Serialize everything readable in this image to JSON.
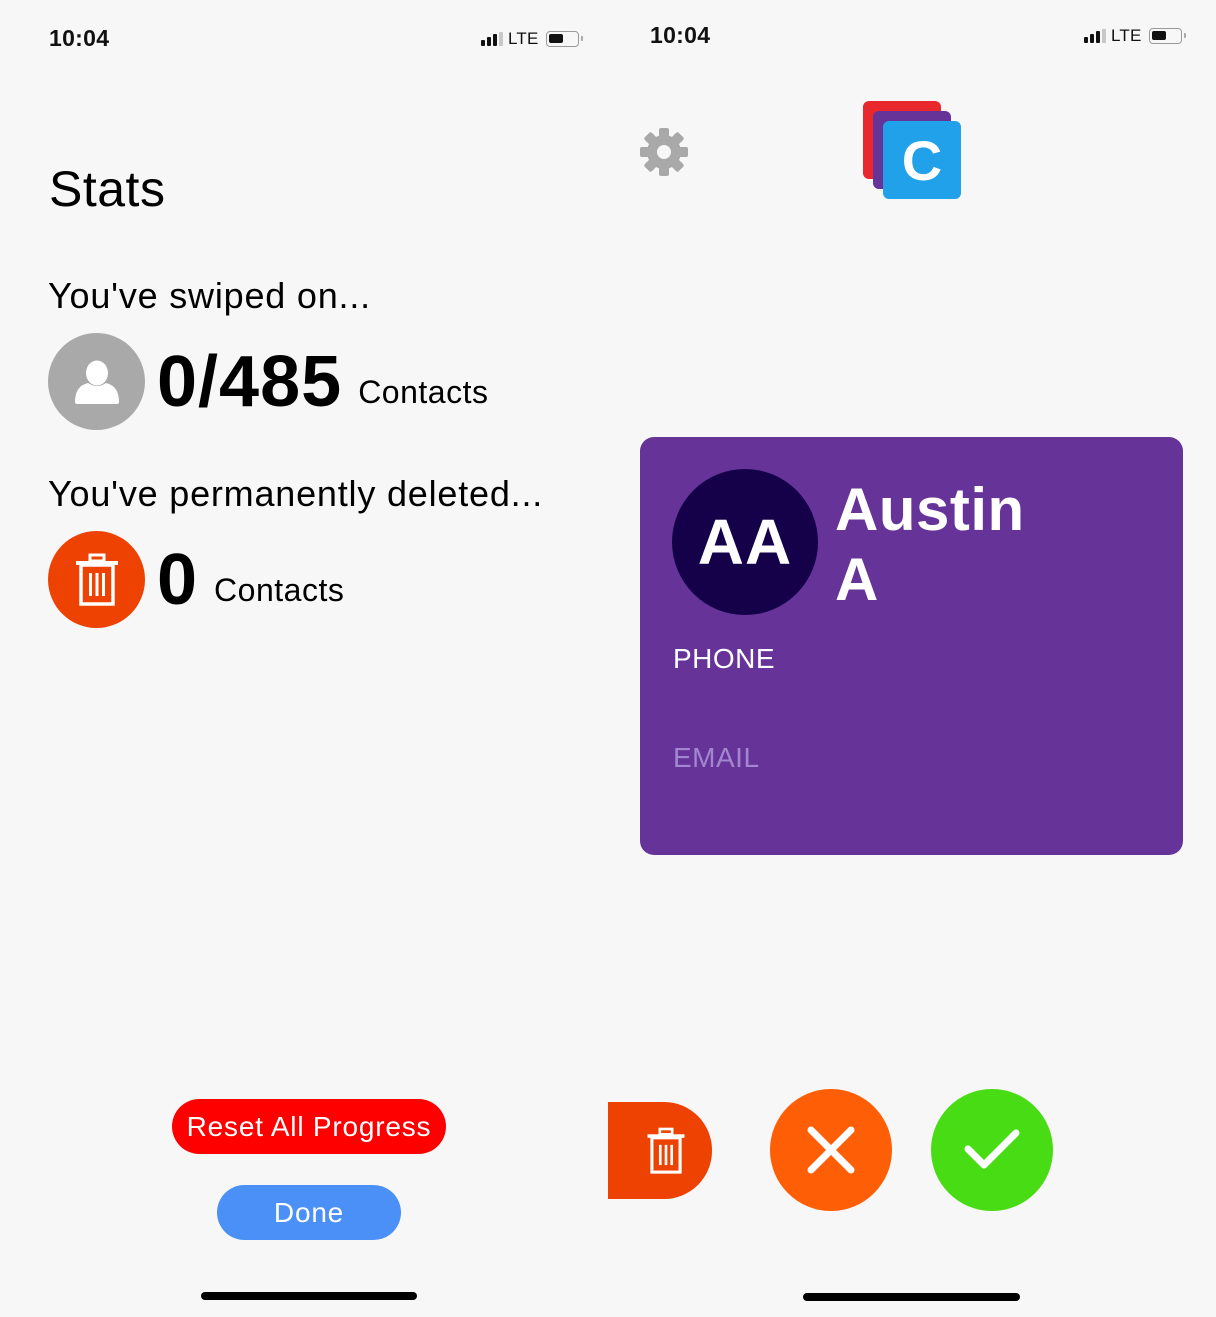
{
  "status_bar": {
    "time": "10:04",
    "network": "LTE",
    "signal_bars_filled": 3,
    "signal_bars_total": 4,
    "battery_level": 0.5
  },
  "stats_screen": {
    "title": "Stats",
    "swiped": {
      "label": "You've swiped on...",
      "value": "0/485",
      "unit": "Contacts",
      "icon": "person-icon"
    },
    "deleted": {
      "label": "You've permanently deleted...",
      "value": "0",
      "unit": "Contacts",
      "icon": "trash-icon"
    },
    "buttons": {
      "reset": "Reset All Progress",
      "done": "Done"
    }
  },
  "swipe_screen": {
    "settings_icon": "gear-icon",
    "logo_letter": "C",
    "contact": {
      "initials": "AA",
      "first_name": "Austin",
      "last_name": "A",
      "phone_label": "PHONE",
      "email_label": "EMAIL"
    },
    "actions": {
      "delete_icon": "trash-icon",
      "reject_icon": "close-icon",
      "accept_icon": "check-icon"
    }
  },
  "colors": {
    "background": "#f7f7f7",
    "card": "#663399",
    "avatar": "#15004a",
    "delete": "#ee4203",
    "reject": "#fe5e05",
    "accept": "#48dc14",
    "reset_button": "#fe0000",
    "done_button": "#4a90f7",
    "logo_red": "#e8282c",
    "logo_blue": "#22a1eb"
  }
}
